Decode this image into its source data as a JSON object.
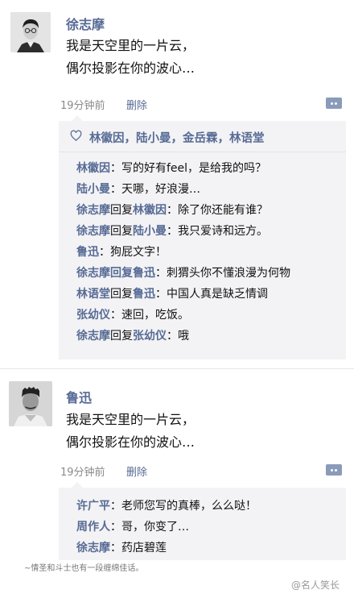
{
  "posts": [
    {
      "name": "徐志摩",
      "lines": [
        "我是天空里的一片云，",
        "偶尔投影在你的波心…"
      ],
      "time": "19分钟前",
      "delete_label": "删除",
      "likes": "林徽因，陆小曼，金岳霖，林语堂",
      "comments": [
        {
          "user": "林徽因",
          "reply_verb": "",
          "reply_to": "",
          "text": "：写的好有feel，是给我的吗？"
        },
        {
          "user": "陆小曼",
          "reply_verb": "",
          "reply_to": "",
          "text": "：天哪，好浪漫…"
        },
        {
          "user": "徐志摩",
          "reply_verb": "回复",
          "reply_to": "林徽因",
          "text": "：除了你还能有谁？"
        },
        {
          "user": "徐志摩",
          "reply_verb": "回复",
          "reply_to": "陆小曼",
          "text": "：我只爱诗和远方。"
        },
        {
          "user": "鲁迅",
          "reply_verb": "",
          "reply_to": "",
          "text": "：狗屁文字！"
        },
        {
          "user": "徐志摩",
          "reply_verb": "回复",
          "reply_to": "鲁迅",
          "text": "：刺猬头你不懂浪漫为何物"
        },
        {
          "user": "林语堂",
          "reply_verb": "回复",
          "reply_to": "鲁迅",
          "text": "：中国人真是缺乏情调"
        },
        {
          "user": "张幼仪",
          "reply_verb": "",
          "reply_to": "",
          "text": "：速回，吃饭。"
        },
        {
          "user": "徐志摩",
          "reply_verb": "回复",
          "reply_to": "张幼仪",
          "text": "：哦"
        }
      ]
    },
    {
      "name": "鲁迅",
      "lines": [
        "我是天空里的一片云，",
        "偶尔投影在你的波心…"
      ],
      "time": "19分钟前",
      "delete_label": "删除",
      "comments": [
        {
          "user": "许广平",
          "reply_verb": "",
          "reply_to": "",
          "text": "：老师您写的真棒，么么哒！"
        },
        {
          "user": "周作人",
          "reply_verb": "",
          "reply_to": "",
          "text": "：哥，你变了…"
        },
        {
          "user": "徐志摩",
          "reply_verb": "",
          "reply_to": "",
          "text": "：药店碧莲"
        }
      ]
    }
  ],
  "caption": "~情圣和斗士也有一段缠绵佳话。",
  "watermark": "@名人笑长",
  "colors": {
    "link": "#576b95",
    "comment_bg": "#f3f3f5",
    "more_btn": "#8a9bb9"
  }
}
